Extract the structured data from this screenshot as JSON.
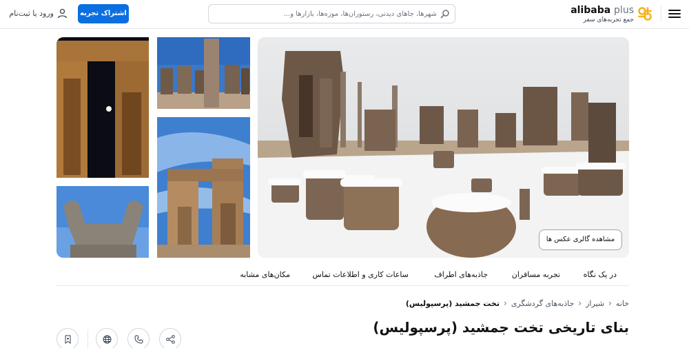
{
  "header": {
    "logo_brand": "alibaba",
    "logo_plus": "plus",
    "logo_tagline": "جمع تجربه‌های سفر",
    "search_placeholder": "شهرها، جاهای دیدنی، رستوران‌ها، موزه‌ها، بازارها و...",
    "share_experience_label": "اشتراک تجربه",
    "login_label": "ورود یا ثبت‌نام",
    "accent_color": "#0b6fe0",
    "logo_color": "#f6b31b"
  },
  "gallery": {
    "view_gallery_label": "مشاهده گالری عکس ها"
  },
  "tabs": [
    {
      "label": "در یک نگاه"
    },
    {
      "label": "تجربه مسافران"
    },
    {
      "label": "جاذبه‌های اطراف"
    },
    {
      "label": "ساعات کاری و اطلاعات تماس"
    },
    {
      "label": "مکان‌های مشابه"
    }
  ],
  "breadcrumb": [
    {
      "label": "خانه"
    },
    {
      "label": "شیراز"
    },
    {
      "label": "جاذبه‌های گردشگری"
    },
    {
      "label": "تخت جمشید (پرسپولیس)"
    }
  ],
  "page_title": "بنای تاریخی تخت جمشید (پرسپولیس)",
  "actions": [
    {
      "icon": "share-icon"
    },
    {
      "icon": "phone-icon"
    },
    {
      "icon": "globe-icon"
    },
    {
      "icon": "bookmark-icon"
    }
  ]
}
